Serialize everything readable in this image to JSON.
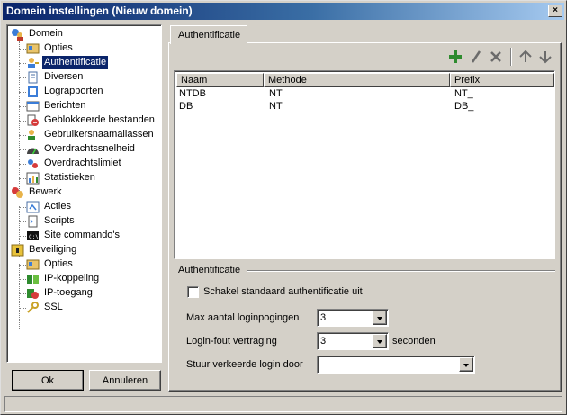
{
  "window": {
    "title": "Domein instellingen (Nieuw domein)",
    "close_label": "×"
  },
  "tree": {
    "items": [
      {
        "label": "Domein",
        "icon": "globe-users-icon"
      },
      {
        "label": "Opties",
        "icon": "options-icon"
      },
      {
        "label": "Authentificatie",
        "icon": "user-key-icon",
        "selected": true
      },
      {
        "label": "Diversen",
        "icon": "document-icon"
      },
      {
        "label": "Lograpporten",
        "icon": "log-book-icon"
      },
      {
        "label": "Berichten",
        "icon": "messages-icon"
      },
      {
        "label": "Geblokkeerde bestanden",
        "icon": "blocked-files-icon"
      },
      {
        "label": "Gebruikersnaamaliassen",
        "icon": "user-alias-icon"
      },
      {
        "label": "Overdrachtssnelheid",
        "icon": "speedometer-icon"
      },
      {
        "label": "Overdrachtslimiet",
        "icon": "transfer-limit-icon"
      },
      {
        "label": "Statistieken",
        "icon": "statistics-icon"
      },
      {
        "label": "Bewerk",
        "icon": "edit-icon"
      },
      {
        "label": "Acties",
        "icon": "actions-icon"
      },
      {
        "label": "Scripts",
        "icon": "scripts-icon"
      },
      {
        "label": "Site commando's",
        "icon": "console-icon"
      },
      {
        "label": "Beveiliging",
        "icon": "security-icon"
      },
      {
        "label": "Opties",
        "icon": "options-icon"
      },
      {
        "label": "IP-koppeling",
        "icon": "ip-binding-icon"
      },
      {
        "label": "IP-toegang",
        "icon": "ip-access-icon"
      },
      {
        "label": "SSL",
        "icon": "key-icon"
      }
    ]
  },
  "buttons": {
    "ok": "Ok",
    "cancel": "Annuleren"
  },
  "tab": {
    "label": "Authentificatie"
  },
  "toolbar": {
    "add": "plus-icon",
    "edit": "pencil-icon",
    "delete": "delete-x-icon",
    "up": "arrow-up-icon",
    "down": "arrow-down-icon",
    "colors": {
      "add": "#2e8b2e",
      "icons": "#6b6b6b"
    }
  },
  "table": {
    "columns": [
      "Naam",
      "Methode",
      "Prefix"
    ],
    "rows": [
      [
        "NTDB",
        "NT",
        "NT_"
      ],
      [
        "DB",
        "NT",
        "DB_"
      ]
    ]
  },
  "group": {
    "label": "Authentificatie",
    "checkbox_label": "Schakel standaard authentificatie uit",
    "max_attempts_label": "Max aantal loginpogingen",
    "max_attempts_value": "3",
    "delay_label": "Login-fout vertraging",
    "delay_value": "3",
    "delay_unit": "seconden",
    "redirect_label": "Stuur verkeerde login door",
    "redirect_value": ""
  },
  "colors": {
    "selection": "#0a246a",
    "face": "#d4d0c8",
    "title_start": "#0a246a",
    "title_end": "#a6caf0"
  }
}
